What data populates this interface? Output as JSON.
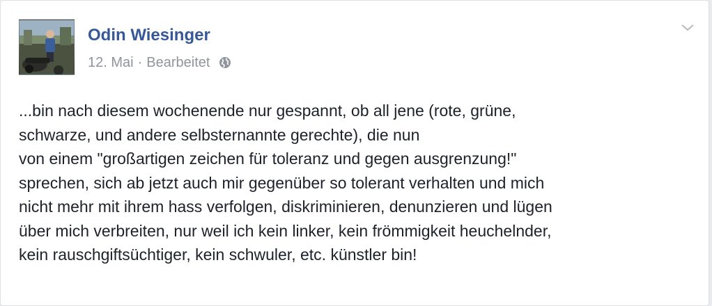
{
  "post": {
    "author": "Odin Wiesinger",
    "date": "12. Mai",
    "separator": "·",
    "edited_label": "Bearbeitet",
    "privacy_icon": "globe-icon",
    "menu_icon": "chevron-down-icon",
    "lines": [
      "...bin nach diesem wochenende nur gespannt, ob all jene (rote, grüne,",
      "schwarze, und andere selbsternannte gerechte), die nun",
      "von einem \"großartigen zeichen für toleranz und gegen ausgrenzung!\"",
      "sprechen, sich ab jetzt auch mir gegenüber so tolerant verhalten und mich",
      "nicht mehr mit ihrem hass verfolgen, diskriminieren, denunzieren und lügen",
      "über mich verbreiten, nur weil ich kein linker, kein frömmigkeit heuchelnder,",
      "kein rauschgiftsüchtiger, kein schwuler, etc. künstler bin!"
    ]
  },
  "colors": {
    "author_link": "#365899",
    "meta_text": "#90949c",
    "body_text": "#1d2129",
    "card_border": "#dddfe2"
  }
}
